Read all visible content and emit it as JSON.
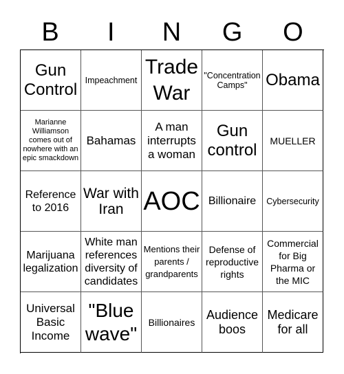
{
  "header": {
    "letters": [
      "B",
      "I",
      "N",
      "G",
      "O"
    ]
  },
  "cells": [
    {
      "text": "Gun Control"
    },
    {
      "text": "Impeachment"
    },
    {
      "text": "Trade War"
    },
    {
      "text": "\"Concentration Camps\""
    },
    {
      "text": "Obama"
    },
    {
      "text": "Marianne Williamson comes out of nowhere with an epic smackdown"
    },
    {
      "text": "Bahamas"
    },
    {
      "text": "A man interrupts a woman"
    },
    {
      "text": "Gun control"
    },
    {
      "text": "MUELLER"
    },
    {
      "text": "Reference to 2016"
    },
    {
      "text": "War with Iran"
    },
    {
      "text": "AOC"
    },
    {
      "text": "Billionaire"
    },
    {
      "text": "Cybersecurity"
    },
    {
      "text": "Marijuana legalization"
    },
    {
      "text": "White man references diversity of candidates"
    },
    {
      "text": "Mentions their parents / grandparents"
    },
    {
      "text": "Defense of reproductive rights"
    },
    {
      "text": "Commercial for Big Pharma or the MIC"
    },
    {
      "text": "Universal Basic Income"
    },
    {
      "text": "\"Blue wave\""
    },
    {
      "text": "Billionaires"
    },
    {
      "text": "Audience boos"
    },
    {
      "text": "Medicare for all"
    }
  ]
}
